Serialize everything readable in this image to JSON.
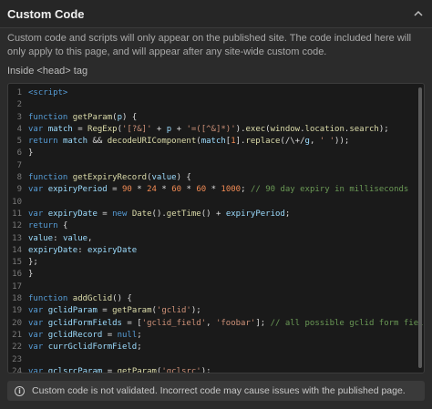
{
  "header": {
    "title": "Custom Code"
  },
  "description": "Custom code and scripts will only appear on the published site. The code included here will only apply to this page, and will appear after any site-wide custom code.",
  "section_label": "Inside <head> tag",
  "editor": {
    "lines": [
      {
        "n": "1",
        "t": "<script>"
      },
      {
        "n": "2",
        "t": ""
      },
      {
        "n": "3",
        "t": "function getParam(p) {"
      },
      {
        "n": "4",
        "t": "var match = RegExp('[?&]' + p + '=([^&]*)').exec(window.location.search);"
      },
      {
        "n": "5",
        "t": "return match && decodeURIComponent(match[1].replace(/\\+/g, ' '));"
      },
      {
        "n": "6",
        "t": "}"
      },
      {
        "n": "7",
        "t": ""
      },
      {
        "n": "8",
        "t": "function getExpiryRecord(value) {"
      },
      {
        "n": "9",
        "t": "var expiryPeriod = 90 * 24 * 60 * 60 * 1000; // 90 day expiry in milliseconds"
      },
      {
        "n": "10",
        "t": ""
      },
      {
        "n": "11",
        "t": "var expiryDate = new Date().getTime() + expiryPeriod;"
      },
      {
        "n": "12",
        "t": "return {"
      },
      {
        "n": "13",
        "t": "value: value,"
      },
      {
        "n": "14",
        "t": "expiryDate: expiryDate"
      },
      {
        "n": "15",
        "t": "};"
      },
      {
        "n": "16",
        "t": "}"
      },
      {
        "n": "17",
        "t": ""
      },
      {
        "n": "18",
        "t": "function addGclid() {"
      },
      {
        "n": "19",
        "t": "var gclidParam = getParam('gclid');"
      },
      {
        "n": "20",
        "t": "var gclidFormFields = ['gclid_field', 'foobar']; // all possible gclid form field ids he"
      },
      {
        "n": "21",
        "t": "var gclidRecord = null;"
      },
      {
        "n": "22",
        "t": "var currGclidFormField;"
      },
      {
        "n": "23",
        "t": ""
      },
      {
        "n": "24",
        "t": "var gclsrcParam = getParam('gclsrc');"
      }
    ]
  },
  "notice": {
    "text": "Custom code is not validated. Incorrect code may cause issues with the published page."
  }
}
